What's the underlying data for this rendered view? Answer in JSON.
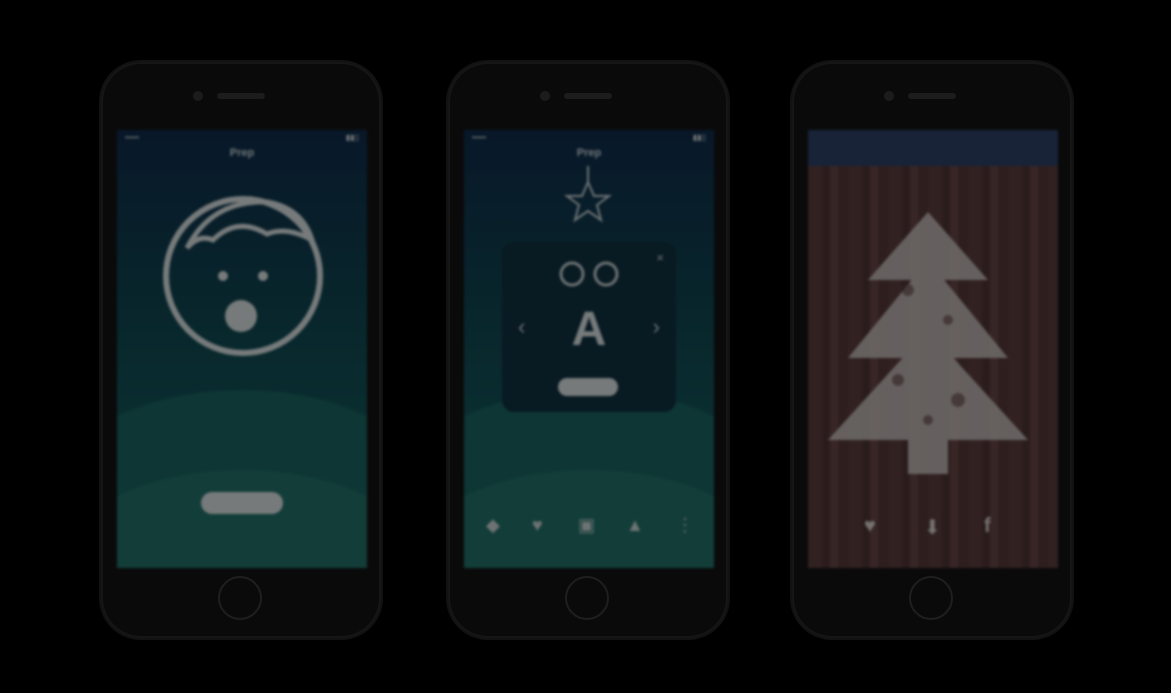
{
  "phones": [
    {
      "status_left": "•••••",
      "status_right": "▮▮▯",
      "title": "Prep",
      "caption": "",
      "subcaption": "",
      "button_label": "",
      "face_icon": "surprised-boy-face-icon"
    },
    {
      "status_left": "•••••",
      "status_right": "▮▮▯",
      "title": "Prep",
      "card_letter": "A",
      "card_button_label": "",
      "card_close": "×",
      "arrow_left": "‹",
      "arrow_right": "›",
      "caption": "",
      "tabs": [
        {
          "icon": "bird-icon",
          "glyph": "◆"
        },
        {
          "icon": "heart-icon",
          "glyph": "♥"
        },
        {
          "icon": "gift-icon",
          "glyph": "▣"
        },
        {
          "icon": "tree-icon",
          "glyph": "▲"
        },
        {
          "icon": "more-icon",
          "glyph": "⋮"
        }
      ]
    },
    {
      "title": "",
      "tree_icon": "christmas-tree-icon",
      "share_twitter": "♥",
      "share_download": "⬇",
      "share_facebook": "f"
    }
  ],
  "colors": {
    "background": "#000000",
    "teal_top": "#0f2b4a",
    "teal_bottom": "#1b6259",
    "wood": "#5a3c3c"
  }
}
